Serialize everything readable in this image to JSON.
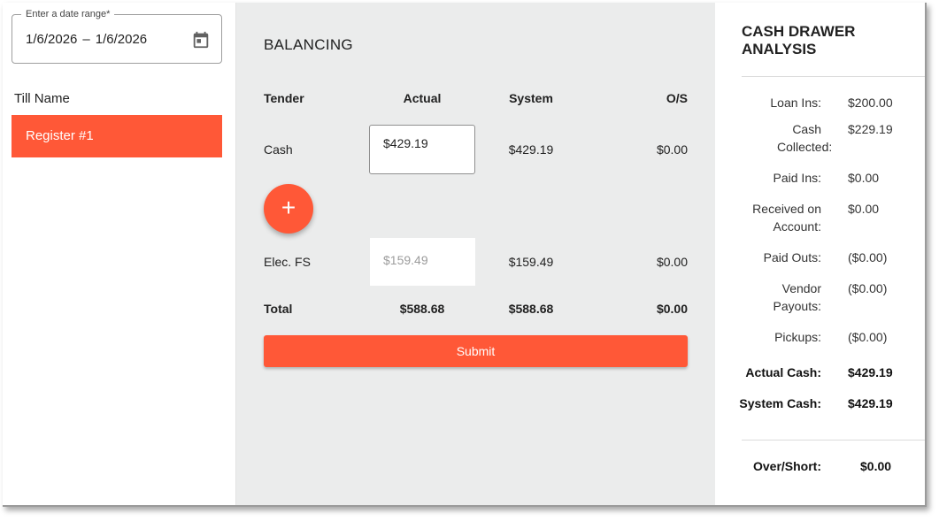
{
  "date_range": {
    "label": "Enter a date range*",
    "start": "1/6/2026",
    "separator": "–",
    "end": "1/6/2026"
  },
  "till": {
    "header": "Till Name",
    "items": [
      {
        "label": "Register #1"
      }
    ]
  },
  "balancing": {
    "title": "BALANCING",
    "headers": {
      "tender": "Tender",
      "actual": "Actual",
      "system": "System",
      "os": "O/S"
    },
    "rows": [
      {
        "tender": "Cash",
        "actual": "$429.19",
        "system": "$429.19",
        "os": "$0.00"
      },
      {
        "tender": "Elec. FS",
        "actual": "$159.49",
        "system": "$159.49",
        "os": "$0.00"
      }
    ],
    "total": {
      "label": "Total",
      "actual": "$588.68",
      "system": "$588.68",
      "os": "$0.00"
    },
    "add_label": "+",
    "submit_label": "Submit"
  },
  "analysis": {
    "title_line1": "CASH DRAWER",
    "title_line2": "ANALYSIS",
    "items": [
      {
        "label": "Loan Ins:",
        "value": "$200.00"
      },
      {
        "label": "Cash Collected:",
        "value": "$229.19"
      },
      {
        "label": "Paid Ins:",
        "value": "$0.00"
      },
      {
        "label": "Received on Account:",
        "value": "$0.00"
      },
      {
        "label": "Paid Outs:",
        "value": "($0.00)"
      },
      {
        "label": "Vendor Payouts:",
        "value": "($0.00)"
      },
      {
        "label": "Pickups:",
        "value": "($0.00)"
      },
      {
        "label": "Actual Cash:",
        "value": "$429.19"
      },
      {
        "label": "System Cash:",
        "value": "$429.19"
      }
    ],
    "over_short": {
      "label": "Over/Short:",
      "value": "$0.00"
    }
  },
  "colors": {
    "accent": "#ff5837",
    "middle_bg": "#ebecec"
  },
  "icons": {
    "calendar": "calendar-icon",
    "add": "plus-icon"
  }
}
